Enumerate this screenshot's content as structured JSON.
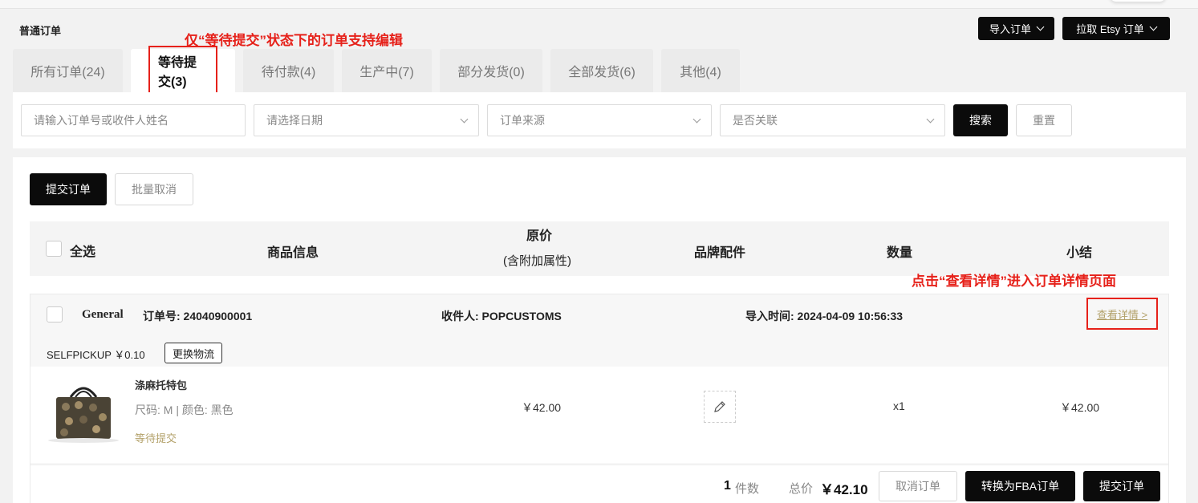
{
  "header": {
    "title": "普通订单",
    "import_orders": "导入订单",
    "pull_etsy": "拉取 Etsy 订单"
  },
  "annotations": {
    "tab_note": "仅“等待提交”状态下的订单支持编辑",
    "detail_note": "点击“查看详情”进入订单详情页面"
  },
  "tabs": [
    {
      "label": "所有订单(24)",
      "active": false
    },
    {
      "label": "等待提交(3)",
      "active": true
    },
    {
      "label": "待付款(4)",
      "active": false
    },
    {
      "label": "生产中(7)",
      "active": false
    },
    {
      "label": "部分发货(0)",
      "active": false
    },
    {
      "label": "全部发货(6)",
      "active": false
    },
    {
      "label": "其他(4)",
      "active": false
    }
  ],
  "filters": {
    "search_placeholder": "请输入订单号或收件人姓名",
    "date_placeholder": "请选择日期",
    "source_placeholder": "订单来源",
    "linked_placeholder": "是否关联",
    "search_btn": "搜索",
    "reset_btn": "重置"
  },
  "actions": {
    "submit_orders": "提交订单",
    "batch_cancel": "批量取消"
  },
  "table_header": {
    "select_all": "全选",
    "product_info": "商品信息",
    "original_price": "原价",
    "original_price_note": "(含附加属性)",
    "brand_parts": "品牌配件",
    "quantity": "数量",
    "subtotal": "小结"
  },
  "order": {
    "channel": "General",
    "order_no": "订单号: 24040900001",
    "recipient": "收件人: POPCUSTOMS",
    "import_time": "导入时间: 2024-04-09 10:56:33",
    "view_detail": "查看详情 >",
    "shipping": "SELFPICKUP ￥0.10",
    "change_logistics": "更换物流",
    "item": {
      "name": "涤麻托特包",
      "attrs": "尺码: M | 颜色: 黑色",
      "status": "等待提交",
      "price": "￥42.00",
      "qty": "x1",
      "subtotal": "￥42.00"
    },
    "footer": {
      "count_num": "1",
      "count_label": "件数",
      "total_label": "总价",
      "total_value": "￥42.10",
      "cancel_btn": "取消订单",
      "fba_btn": "转换为FBA订单",
      "submit_btn": "提交订单"
    }
  },
  "colors": {
    "accent_red": "#e6211a",
    "status_gold": "#b3a16a",
    "dark": "#0b0b0b"
  }
}
